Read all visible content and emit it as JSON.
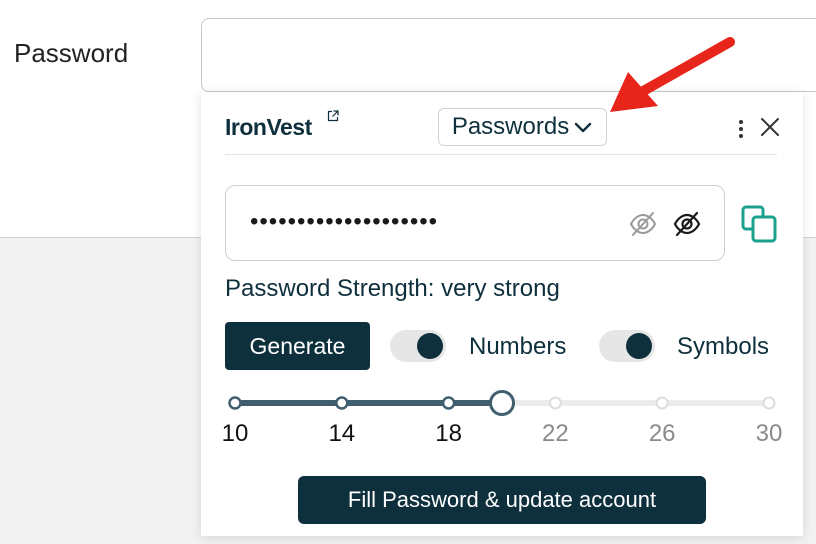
{
  "form": {
    "password_label": "Password"
  },
  "popup": {
    "brand": "IronVest",
    "mode_select": {
      "value": "Passwords"
    },
    "password_masked": "••••••••••••••••••••",
    "strength_label": "Password Strength:",
    "strength_value": "very strong",
    "generate_label": "Generate",
    "options": [
      {
        "label": "Numbers",
        "enabled": true
      },
      {
        "label": "Symbols",
        "enabled": true
      }
    ],
    "length_slider": {
      "ticks": [
        "10",
        "14",
        "18",
        "22",
        "26",
        "30"
      ],
      "value": 20,
      "min": 10,
      "max": 30
    },
    "fill_button_label": "Fill Password & update account"
  },
  "colors": {
    "brand_dark": "#0e2f3c",
    "accent_teal": "#1aa08e",
    "arrow_red": "#e8251b"
  },
  "icons": [
    "external-link-icon",
    "chevron-down-icon",
    "kebab-menu-icon",
    "close-icon",
    "eye-slash-icon",
    "copy-icon",
    "red-arrow"
  ]
}
